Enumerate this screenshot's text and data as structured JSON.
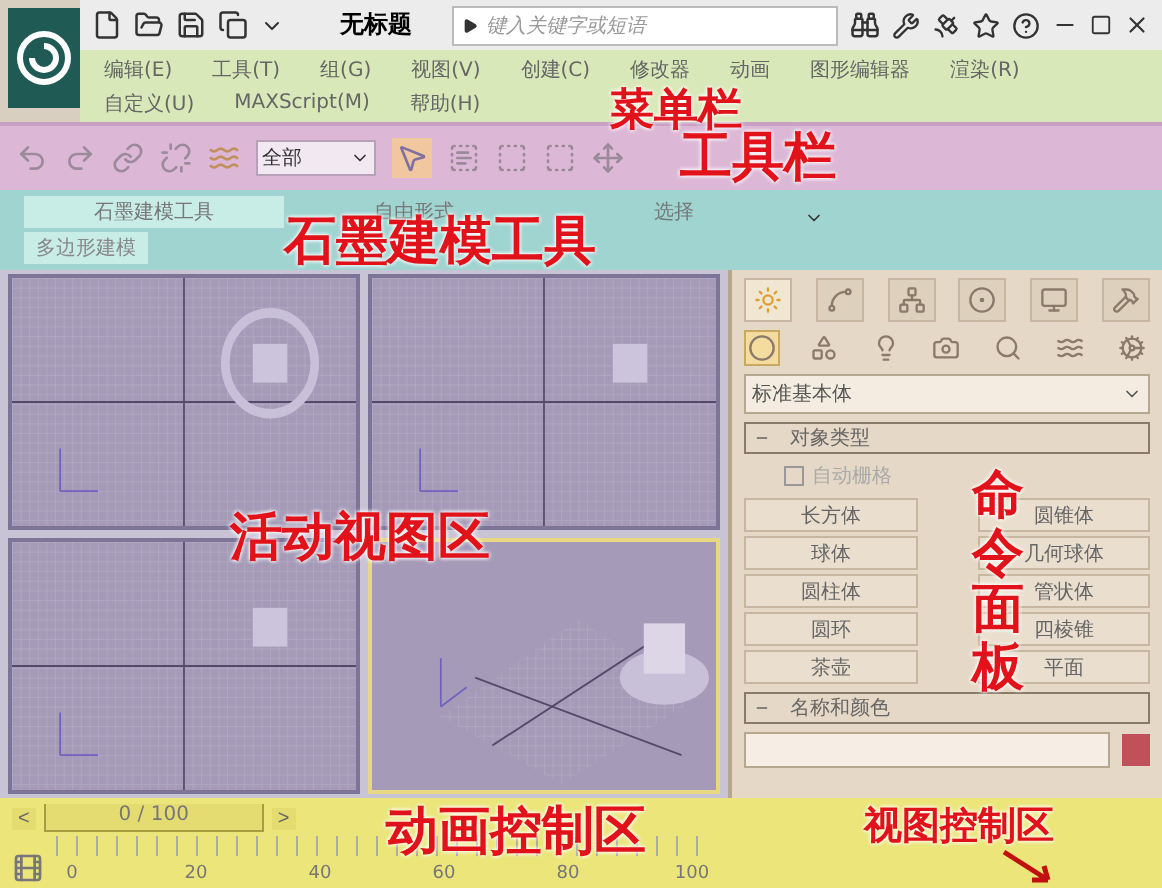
{
  "window": {
    "title": "无标题",
    "search": {
      "placeholder": "键入关键字或短语"
    }
  },
  "menu": [
    [
      "编辑(E)",
      "工具(T)",
      "组(G)",
      "视图(V)",
      "创建(C)",
      "修改器",
      "动画",
      "图形编辑器",
      "渲染(R)"
    ],
    [
      "自定义(U)",
      "MAXScript(M)",
      "帮助(H)"
    ]
  ],
  "toolbar": {
    "selection_filter": "全部"
  },
  "ribbon": {
    "tabs": [
      {
        "label": "石墨建模工具",
        "selected": true
      },
      {
        "label": "自由形式",
        "selected": false
      },
      {
        "label": "选择",
        "selected": false
      }
    ],
    "subtab": "多边形建模"
  },
  "viewports": [
    {
      "kind": "ortho",
      "active": false
    },
    {
      "kind": "ortho",
      "active": false
    },
    {
      "kind": "ortho",
      "active": false
    },
    {
      "kind": "perspective",
      "active": true
    }
  ],
  "command_panel": {
    "tabs": [
      {
        "selected": true
      },
      {
        "selected": false
      },
      {
        "selected": false
      },
      {
        "selected": false
      },
      {
        "selected": false
      },
      {
        "selected": false
      }
    ],
    "categories": [
      {
        "selected": true
      },
      {
        "selected": false
      },
      {
        "selected": false
      },
      {
        "selected": false
      },
      {
        "selected": false
      },
      {
        "selected": false
      },
      {
        "selected": false
      }
    ],
    "dropdown": "标准基本体",
    "object_type": {
      "title": "对象类型",
      "autogrid": {
        "label": "自动栅格",
        "checked": false
      },
      "buttons": [
        "长方体",
        "圆锥体",
        "球体",
        "几何球体",
        "圆柱体",
        "管状体",
        "圆环",
        "四棱锥",
        "茶壶",
        "平面"
      ]
    },
    "name_color": {
      "title": "名称和颜色",
      "color": "#c0505a"
    }
  },
  "timeline": {
    "prev": "<",
    "slider": "0 / 100",
    "level": 0,
    "next": ">",
    "ticks": [
      "0",
      "20",
      "40",
      "60",
      "80",
      "100"
    ]
  },
  "annotations": [
    {
      "text": "菜单栏",
      "kind": "menu"
    },
    {
      "text": "工具栏",
      "kind": "toolbar"
    },
    {
      "text": "石墨建模工具",
      "kind": "ribbon"
    },
    {
      "text": "活动视图区",
      "kind": "viewports"
    },
    {
      "text": "命令面板",
      "kind": "command"
    },
    {
      "text": "动画控制区",
      "kind": "animation"
    },
    {
      "text": "视图控制区",
      "kind": "viewnav"
    }
  ]
}
